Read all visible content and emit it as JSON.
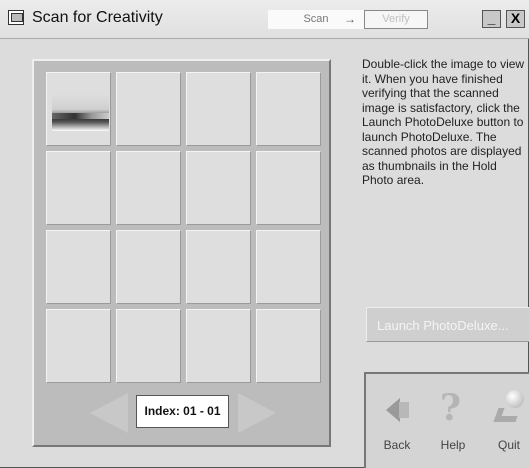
{
  "window": {
    "title": "Scan for Creativity",
    "minimize_label": "_",
    "close_label": "X"
  },
  "steps": {
    "scan_label": "Scan",
    "arrow": "→",
    "verify_label": "Verify"
  },
  "pager": {
    "index_label": "Index: 01 - 01"
  },
  "instructions": "Double-click the image to view it. When you have finished verifying that the scanned image is satisfactory, click the Launch PhotoDeluxe button to launch PhotoDeluxe. The scanned photos are displayed as thumbnails in the Hold Photo area.",
  "launch_button": "Launch PhotoDeluxe...",
  "nav": {
    "back_label": "Back",
    "help_label": "Help",
    "quit_label": "Quit",
    "help_glyph": "?"
  },
  "thumbnails": [
    {
      "cell": 0,
      "icon": "landscape-photo"
    }
  ]
}
